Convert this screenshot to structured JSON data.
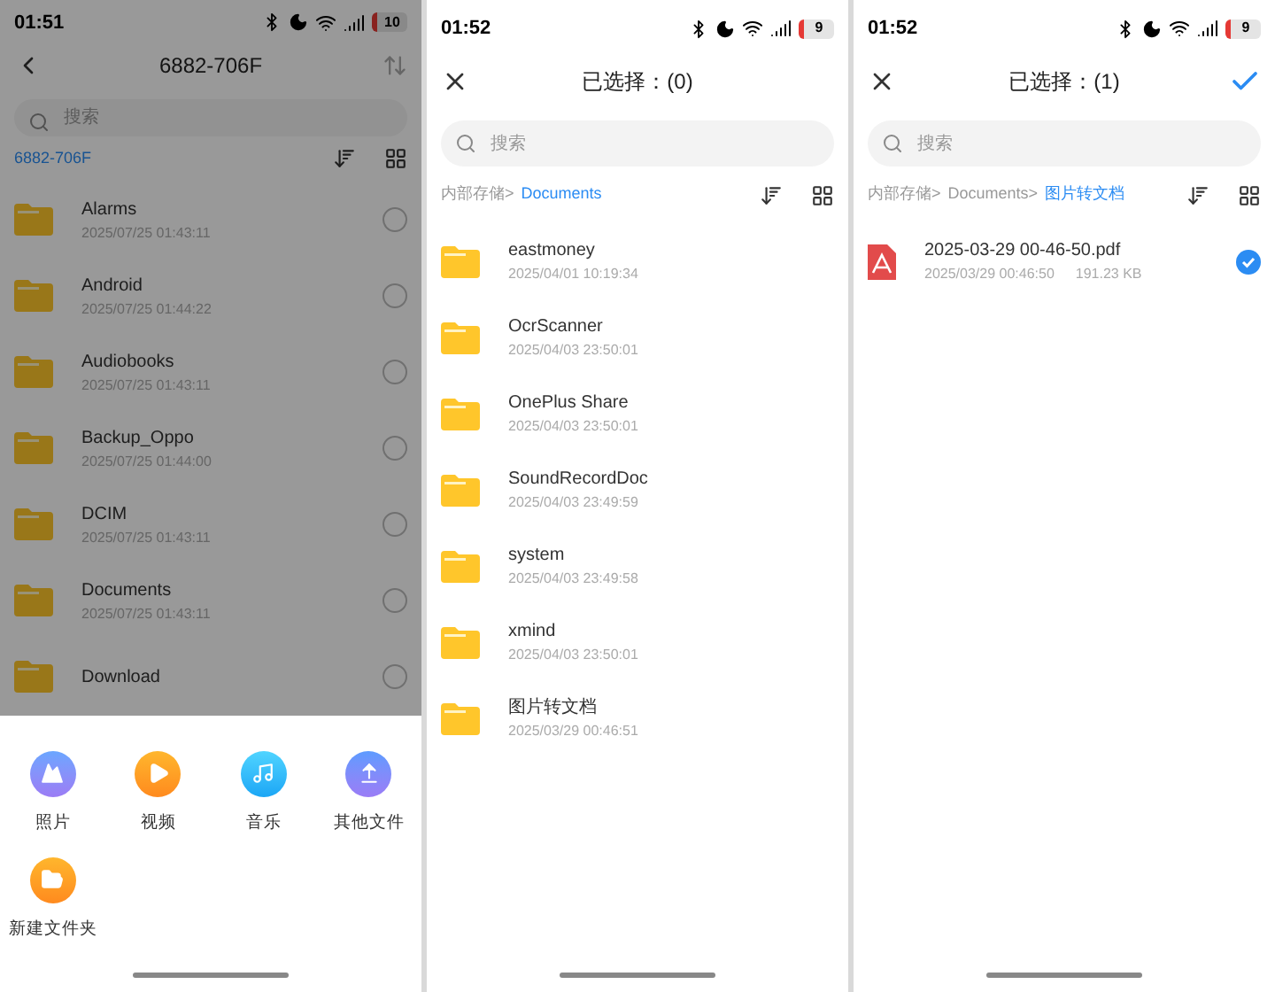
{
  "screens": [
    {
      "status": {
        "time": "01:51",
        "battery": "10"
      },
      "header": {
        "left": {
          "kind": "back"
        },
        "title": "6882-706F",
        "right": {
          "kind": "swap"
        }
      },
      "search": {
        "placeholder": "搜索"
      },
      "dimmed": true,
      "breadcrumb": [
        {
          "label": "6882-706F",
          "selected": true
        }
      ],
      "items": [
        {
          "kind": "folder",
          "name": "Alarms",
          "date": "2025/07/25 01:43:11",
          "checked": false
        },
        {
          "kind": "folder",
          "name": "Android",
          "date": "2025/07/25 01:44:22",
          "checked": false
        },
        {
          "kind": "folder",
          "name": "Audiobooks",
          "date": "2025/07/25 01:43:11",
          "checked": false
        },
        {
          "kind": "folder",
          "name": "Backup_Oppo",
          "date": "2025/07/25 01:44:00",
          "checked": false
        },
        {
          "kind": "folder",
          "name": "DCIM",
          "date": "2025/07/25 01:43:11",
          "checked": false
        },
        {
          "kind": "folder",
          "name": "Documents",
          "date": "2025/07/25 01:43:11",
          "checked": false
        },
        {
          "kind": "folder",
          "name": "Download",
          "checked": false
        }
      ],
      "sheet": [
        {
          "kind": "photo",
          "label": "照片"
        },
        {
          "kind": "video",
          "label": "视频"
        },
        {
          "kind": "music",
          "label": "音乐"
        },
        {
          "kind": "upload",
          "label": "其他文件"
        },
        {
          "kind": "folder",
          "label": "新建文件夹"
        }
      ]
    },
    {
      "status": {
        "time": "01:52",
        "battery": "9"
      },
      "header": {
        "left": {
          "kind": "close"
        },
        "title": "已选择：(0)"
      },
      "search": {
        "placeholder": "搜索"
      },
      "dimmed": false,
      "breadcrumb": [
        {
          "label": "内部存储>",
          "selected": false
        },
        {
          "label": "Documents",
          "selected": true
        }
      ],
      "items": [
        {
          "kind": "folder",
          "name": "eastmoney",
          "date": "2025/04/01 10:19:34"
        },
        {
          "kind": "folder",
          "name": "OcrScanner",
          "date": "2025/04/03 23:50:01"
        },
        {
          "kind": "folder",
          "name": "OnePlus Share",
          "date": "2025/04/03 23:50:01"
        },
        {
          "kind": "folder",
          "name": "SoundRecordDoc",
          "date": "2025/04/03 23:49:59"
        },
        {
          "kind": "folder",
          "name": "system",
          "date": "2025/04/03 23:49:58"
        },
        {
          "kind": "folder",
          "name": "xmind",
          "date": "2025/04/03 23:50:01"
        },
        {
          "kind": "folder",
          "name": "图片转文档",
          "date": "2025/03/29 00:46:51"
        }
      ]
    },
    {
      "status": {
        "time": "01:52",
        "battery": "9"
      },
      "header": {
        "left": {
          "kind": "close"
        },
        "title": "已选择：(1)",
        "right": {
          "kind": "confirm"
        }
      },
      "search": {
        "placeholder": "搜索"
      },
      "dimmed": false,
      "breadcrumb": [
        {
          "label": "内部存储>",
          "selected": false
        },
        {
          "label": "Documents>",
          "selected": false
        },
        {
          "label": "图片转文档",
          "selected": true
        }
      ],
      "items": [
        {
          "kind": "pdf",
          "name": "2025-03-29 00-46-50.pdf",
          "date": "2025/03/29 00:46:50",
          "size": "191.23 KB",
          "checked": true
        }
      ]
    }
  ]
}
